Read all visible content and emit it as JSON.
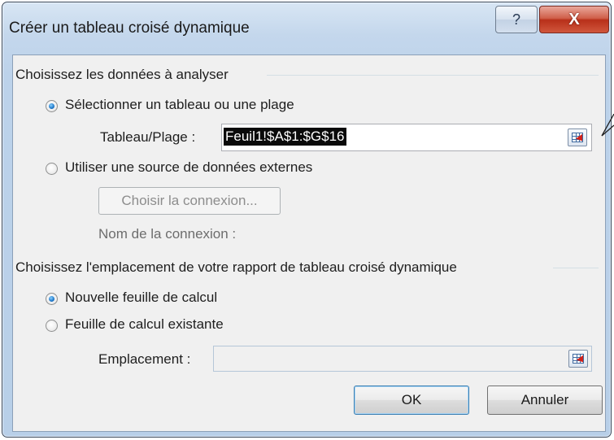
{
  "window": {
    "title": "Créer un tableau croisé dynamique",
    "help_symbol": "?",
    "close_symbol": "X"
  },
  "data_section": {
    "heading": "Choisissez les données à analyser",
    "option_table": {
      "label": "Sélectionner un tableau ou une plage",
      "checked": true
    },
    "table_range": {
      "label": "Tableau/Plage :",
      "value": "Feuil1!$A$1:$G$16"
    },
    "option_external": {
      "label": "Utiliser une source de données externes",
      "checked": false
    },
    "choose_connection_label": "Choisir la connexion...",
    "connection_name_label": "Nom de la connexion :"
  },
  "location_section": {
    "heading": "Choisissez l'emplacement de votre rapport de tableau croisé dynamique",
    "option_new_sheet": {
      "label": "Nouvelle feuille de calcul",
      "checked": true
    },
    "option_existing_sheet": {
      "label": "Feuille de calcul existante",
      "checked": false
    },
    "location_field": {
      "label": "Emplacement :",
      "value": ""
    }
  },
  "buttons": {
    "ok": "OK",
    "cancel": "Annuler"
  }
}
